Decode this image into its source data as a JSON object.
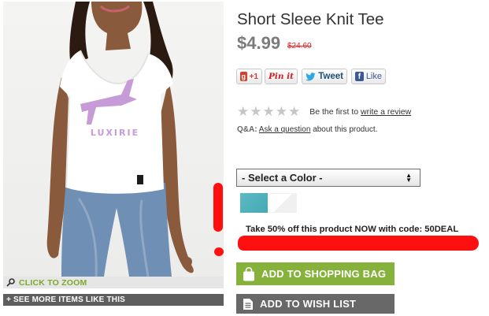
{
  "product": {
    "title": "Short Sleee Knit Tee",
    "price": "$4.99",
    "original_price": "$24.60",
    "shirt_print_text": "LUXIRIE"
  },
  "image_actions": {
    "zoom_label": "CLICK TO ZOOM",
    "see_more_label": "+ SEE MORE ITEMS LIKE THIS"
  },
  "social": {
    "gplus_label": "+1",
    "pinit_label": "Pin it",
    "tweet_label": "Tweet",
    "like_label": "Like"
  },
  "reviews": {
    "stars_filled": 0,
    "stars_total": 5,
    "prefix": "Be the first to",
    "link": "write a review"
  },
  "qa": {
    "label": "Q&A:",
    "link": "Ask a question",
    "suffix": "about this product."
  },
  "color_select": {
    "selected": "- Select a Color -",
    "swatches": [
      "teal",
      "white"
    ]
  },
  "promo_text": "Take 50% off this product NOW with code: 50DEAL",
  "buttons": {
    "add_to_bag": "ADD TO SHOPPING BAG",
    "add_to_wishlist": "ADD TO WISH LIST"
  },
  "colors": {
    "accent_green": "#86b23c",
    "annotation_red": "#ff1010",
    "price_strike_red": "#e02424",
    "wishlist_gray": "#686868"
  }
}
